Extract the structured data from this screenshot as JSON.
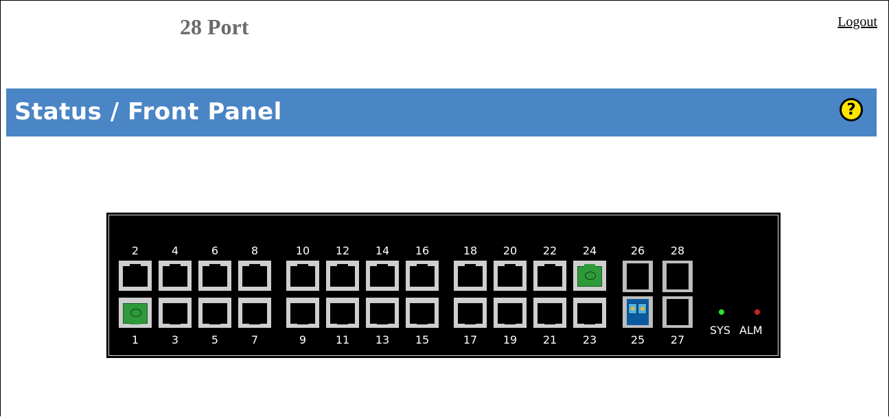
{
  "header": {
    "model_title": "28 Port",
    "logout_label": "Logout"
  },
  "banner": {
    "title": "Status / Front Panel",
    "help_label": "?"
  },
  "panel": {
    "top_row_numbers": [
      "2",
      "4",
      "6",
      "8",
      "10",
      "12",
      "14",
      "16",
      "18",
      "20",
      "22",
      "24",
      "26",
      "28"
    ],
    "bottom_row_numbers": [
      "1",
      "3",
      "5",
      "7",
      "9",
      "11",
      "13",
      "15",
      "17",
      "19",
      "21",
      "23",
      "25",
      "27"
    ],
    "active_ports": [
      "1",
      "24",
      "25"
    ],
    "sys_label": "SYS",
    "alm_label": "ALM",
    "sys_led_color": "#33dd33",
    "alm_led_color": "#cc2222"
  },
  "colors": {
    "banner": "#4a85c5",
    "port_active": "#2f9a3a"
  }
}
